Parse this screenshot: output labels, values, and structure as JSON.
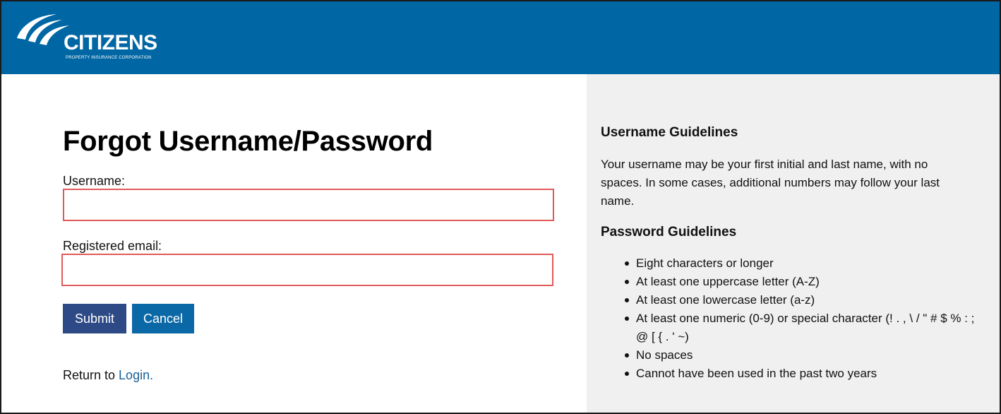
{
  "brand": {
    "name": "CITIZENS",
    "tagline": "PROPERTY INSURANCE CORPORATION",
    "header_color": "#0067a4"
  },
  "form": {
    "title": "Forgot Username/Password",
    "username_label": "Username:",
    "username_value": "",
    "email_label": "Registered email:",
    "email_value": "",
    "submit_label": "Submit",
    "cancel_label": "Cancel",
    "return_prefix": "Return to ",
    "return_link": "Login."
  },
  "guidelines": {
    "username_heading": "Username Guidelines",
    "username_text": "Your username may be your first initial and last name, with no spaces. In some cases, additional numbers may follow your last name.",
    "password_heading": "Password Guidelines",
    "password_items": [
      "Eight characters or longer",
      "At least one uppercase letter (A-Z)",
      "At least one lowercase letter (a-z)",
      "At least one numeric (0-9) or special character (! . , \\ / \" # $ % : ; @ [ { . ' ~)",
      "No spaces",
      "Cannot have been used in the past two years"
    ]
  },
  "colors": {
    "error_border": "#e05a5a",
    "submit_bg": "#2e4a86",
    "cancel_bg": "#0b68a6",
    "link": "#1a5f96",
    "sidebar_bg": "#f0f0f0"
  }
}
